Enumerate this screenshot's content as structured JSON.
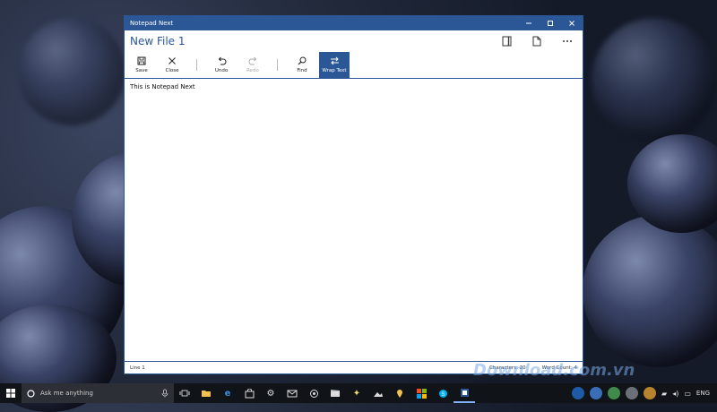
{
  "window": {
    "app_title": "Notepad Next",
    "file_title": "New File 1"
  },
  "toolbar": {
    "items": [
      {
        "label": "Save",
        "icon": "save-icon",
        "state": "normal"
      },
      {
        "label": "Close",
        "icon": "close-icon",
        "state": "normal"
      },
      {
        "label": "Undo",
        "icon": "undo-icon",
        "state": "normal"
      },
      {
        "label": "Redo",
        "icon": "redo-icon",
        "state": "disabled"
      },
      {
        "label": "Find",
        "icon": "search-icon",
        "state": "normal"
      },
      {
        "label": "Wrap Text",
        "icon": "wrap-text-icon",
        "state": "active"
      }
    ]
  },
  "editor": {
    "content": "This is Notepad Next"
  },
  "status": {
    "line": "Line 1",
    "characters": "Characters: 20",
    "words": "Word Count: 4"
  },
  "watermark": "Download.com.vn",
  "taskbar": {
    "search_placeholder": "Ask me anything",
    "language": "ENG"
  },
  "colors": {
    "accent": "#2b5797",
    "taskbar": "#101318"
  }
}
